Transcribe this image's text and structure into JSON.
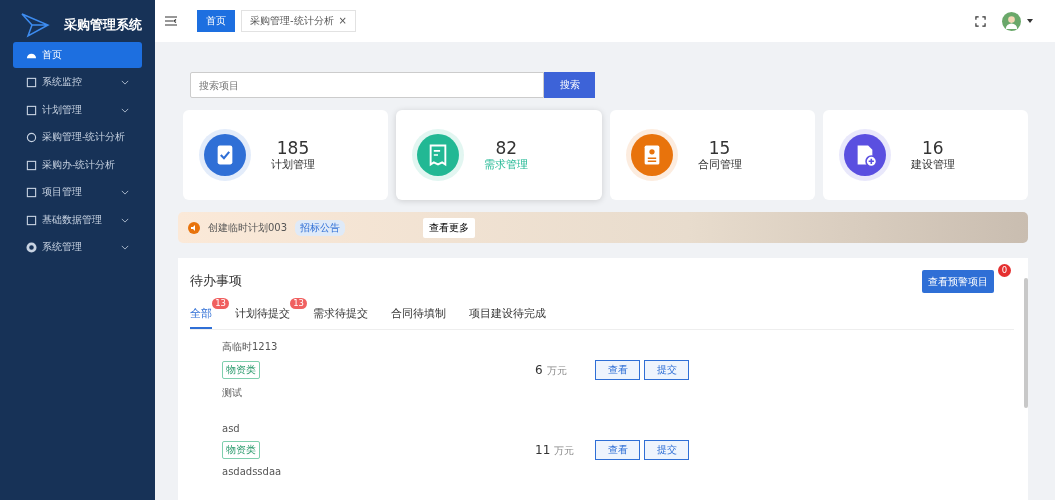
{
  "sidebar": {
    "title": "采购管理系统",
    "items": [
      {
        "label": "首页",
        "selected": true,
        "expandable": false
      },
      {
        "label": "系统监控",
        "selected": false,
        "expandable": true
      },
      {
        "label": "计划管理",
        "selected": false,
        "expandable": true
      },
      {
        "label": "采购管理-统计分析",
        "selected": false,
        "expandable": false
      },
      {
        "label": "采购办-统计分析",
        "selected": false,
        "expandable": false
      },
      {
        "label": "项目管理",
        "selected": false,
        "expandable": true
      },
      {
        "label": "基础数据管理",
        "selected": false,
        "expandable": true
      },
      {
        "label": "系统管理",
        "selected": false,
        "expandable": true
      }
    ]
  },
  "header": {
    "tabs": [
      {
        "label": "首页",
        "selected": true,
        "closable": false
      },
      {
        "label": "采购管理-统计分析",
        "selected": false,
        "closable": true
      }
    ],
    "close_mark": "×"
  },
  "search": {
    "placeholder": "搜索项目",
    "button": "搜索"
  },
  "stats": [
    {
      "value": "185",
      "label": "计划管理",
      "color": "#2f6fd6",
      "selected": false
    },
    {
      "value": "82",
      "label": "需求管理",
      "color": "#22b894",
      "selected": true
    },
    {
      "value": "15",
      "label": "合同管理",
      "color": "#e8730c",
      "selected": false
    },
    {
      "value": "16",
      "label": "建设管理",
      "color": "#5a4fe0",
      "selected": false
    }
  ],
  "notice": {
    "text": "创建临时计划003",
    "tag": "招标公告",
    "more": "查看更多"
  },
  "todo": {
    "title": "待办事项",
    "alert_button": "查看预警项目",
    "alert_count": "0",
    "tabs": [
      {
        "label": "全部",
        "selected": true,
        "badge": "13"
      },
      {
        "label": "计划待提交",
        "selected": false,
        "badge": "13"
      },
      {
        "label": "需求待提交",
        "selected": false
      },
      {
        "label": "合同待填制",
        "selected": false
      },
      {
        "label": "项目建设待完成",
        "selected": false
      }
    ],
    "items": [
      {
        "title": "高临时1213",
        "tag": "物资类",
        "desc": "测试",
        "amount": "6",
        "unit": "万元",
        "actions": [
          "查看",
          "提交"
        ]
      },
      {
        "title": "asd",
        "tag": "物资类",
        "desc": "asdadssdaa",
        "amount": "11",
        "unit": "万元",
        "actions": [
          "查看",
          "提交"
        ]
      }
    ]
  }
}
